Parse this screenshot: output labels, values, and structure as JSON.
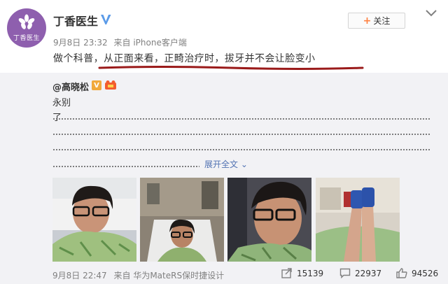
{
  "post": {
    "author": "丁香医生",
    "avatar_text": "丁香医生",
    "timestamp": "9月8日 23:32",
    "source": "来自 iPhone客户端",
    "text": "做个科普，从正面来看，正畸治疗时，拔牙并不会让脸变小",
    "follow_label": "关注",
    "follow_icon": "+"
  },
  "repost": {
    "author": "@高晓松",
    "verified_badge": "V",
    "line1": "永别",
    "line2": "了",
    "expand_label": "展开全文",
    "expand_icon": "⌄",
    "photos": [
      "photo-1",
      "photo-2",
      "photo-3",
      "photo-4"
    ],
    "timestamp": "9月8日 22:47",
    "source": "来自 华为MateRS保时捷设计",
    "share_count": "15139",
    "comment_count": "22937",
    "like_count": "94526"
  },
  "colors": {
    "avatar": "#8e5fae",
    "accent_orange": "#ff8140",
    "link_blue": "#5273b3",
    "underline_red": "#9a1a1a",
    "repost_bg": "#f2f2f5"
  }
}
